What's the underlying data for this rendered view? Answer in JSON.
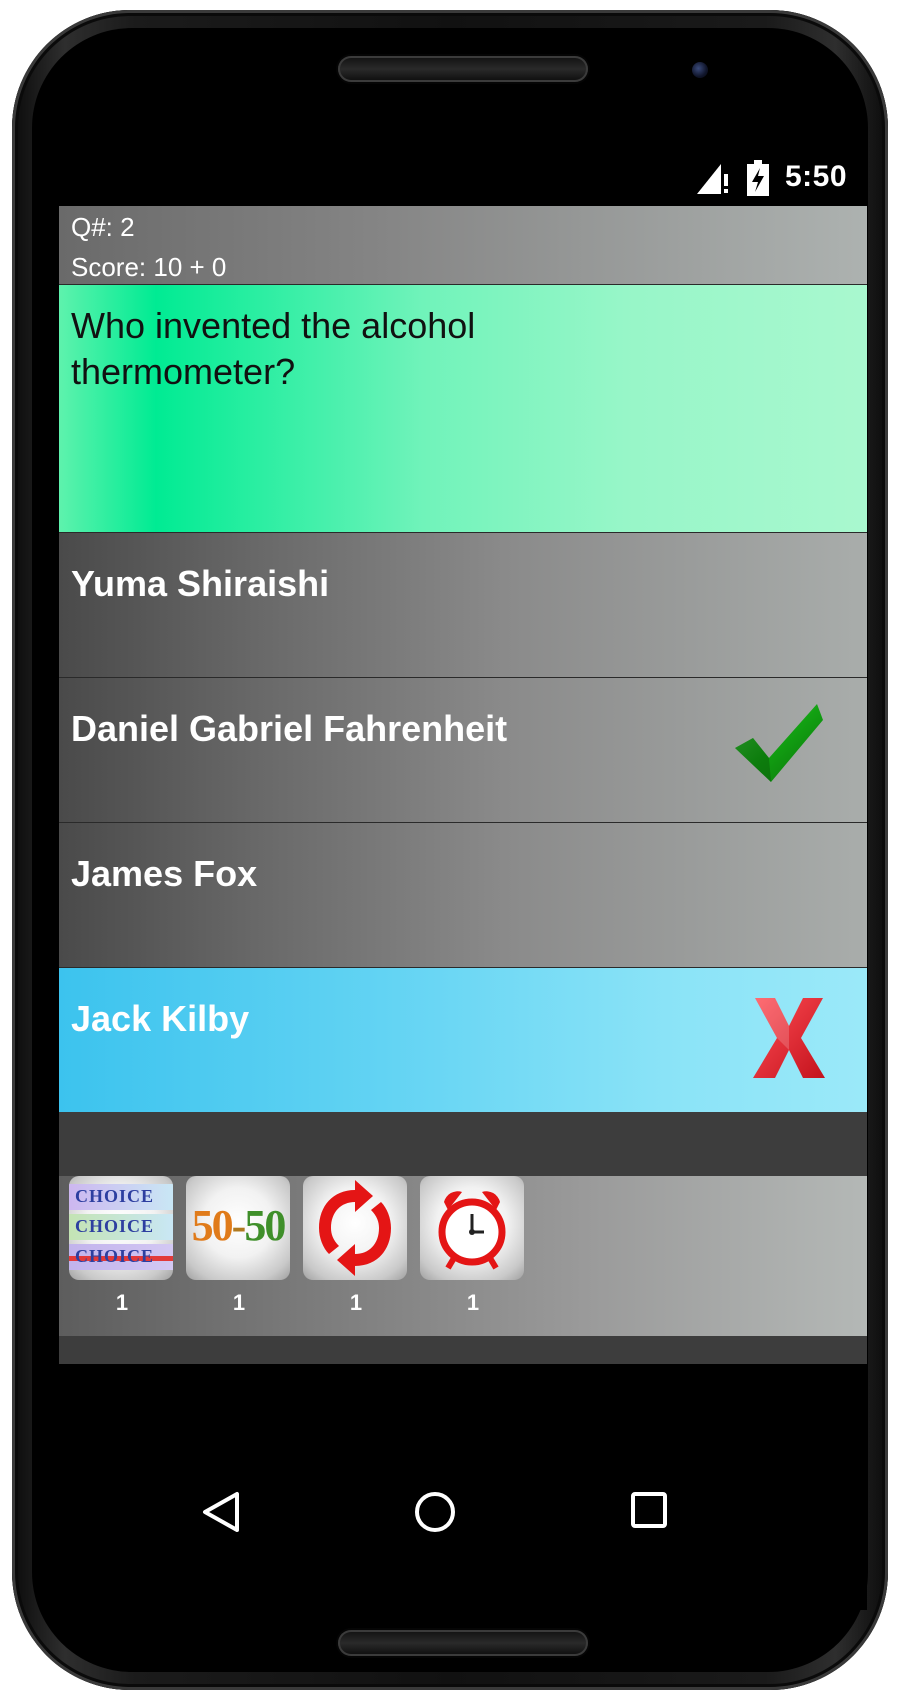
{
  "status_bar": {
    "time": "5:50"
  },
  "info": {
    "question_number": "Q#: 2",
    "score": "Score: 10 + 0"
  },
  "question": {
    "text": "Who invented the alcohol thermometer?"
  },
  "answers": [
    {
      "label": "Yuma Shiraishi",
      "state": "none"
    },
    {
      "label": "Daniel Gabriel Fahrenheit",
      "state": "correct",
      "icon": "checkmark-icon"
    },
    {
      "label": "James Fox",
      "state": "none"
    },
    {
      "label": "Jack Kilby",
      "state": "wrong-selected",
      "icon": "x-mark-icon"
    }
  ],
  "lifelines": [
    {
      "icon": "multiple-choice-icon",
      "art_text": "CHOICE",
      "count": "1"
    },
    {
      "icon": "fifty-fifty-icon",
      "art_text": "50-50",
      "count": "1"
    },
    {
      "icon": "swap-question-icon",
      "count": "1"
    },
    {
      "icon": "alarm-clock-icon",
      "count": "1"
    }
  ],
  "nav": {
    "back_icon": "back-triangle-icon",
    "home_icon": "home-circle-icon",
    "recents_icon": "recents-square-icon"
  },
  "colors": {
    "question_bg": "#00eb93",
    "wrong_bg": "#62d3f3",
    "correct_check": "#12a112",
    "wrong_x": "#e3202a"
  }
}
